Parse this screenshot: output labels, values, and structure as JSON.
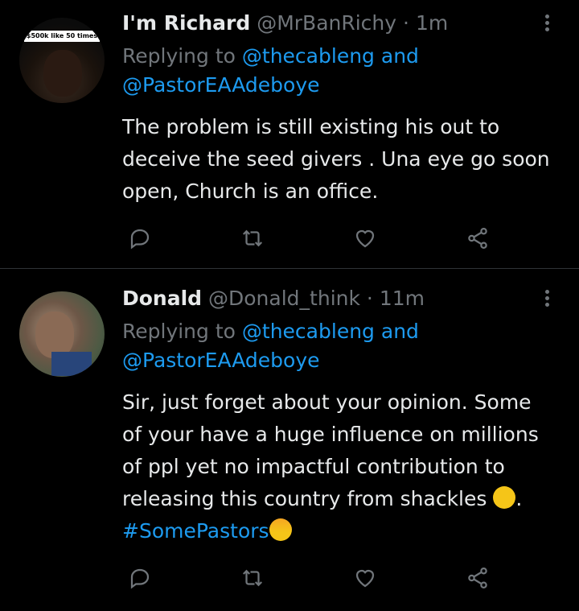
{
  "tweets": [
    {
      "name": "I'm Richard",
      "handle": "@MrBanRichy",
      "separator": "·",
      "time": "1m",
      "replying_prefix": "Replying to",
      "mention1": "@thecableng",
      "and": "and",
      "mention2": "@PastorEAAdeboye",
      "avatar_caption": "$500k like 50 times",
      "text": "The problem is still existing his out to deceive the seed givers . Una eye go soon open, Church is an office."
    },
    {
      "name": "Donald",
      "handle": "@Donald_think",
      "separator": "·",
      "time": "11m",
      "replying_prefix": "Replying to",
      "mention1": "@thecableng",
      "and": "and",
      "mention2": "@PastorEAAdeboye",
      "text_main": "Sir, just forget about your opinion. Some of your have a huge influence on millions of ppl yet no impactful contribution to releasing this country from shackles ",
      "text_after_emoji": ". ",
      "hashtag": "#SomePastors"
    }
  ],
  "icons": {
    "reply": "reply-icon",
    "retweet": "retweet-icon",
    "like": "heart-icon",
    "share": "share-icon",
    "more": "more-icon"
  },
  "colors": {
    "background": "#000000",
    "text": "#e7e9ea",
    "muted": "#71767b",
    "accent": "#1d9bf0",
    "divider": "#2f3336"
  }
}
